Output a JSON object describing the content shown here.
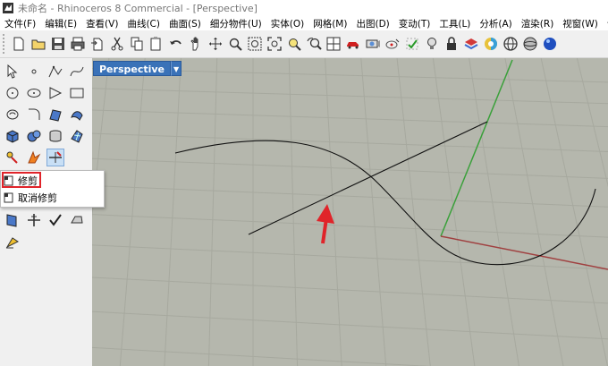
{
  "window": {
    "title": "未命名 - Rhinoceros 8 Commercial - [Perspective]"
  },
  "menu": [
    "文件(F)",
    "编辑(E)",
    "查看(V)",
    "曲线(C)",
    "曲面(S)",
    "细分物件(U)",
    "实体(O)",
    "网格(M)",
    "出图(D)",
    "变动(T)",
    "工具(L)",
    "分析(A)",
    "渲染(R)",
    "视窗(W)",
    "说"
  ],
  "toolbar_icons": [
    "new-icon",
    "open-icon",
    "save-icon",
    "print-icon",
    "import-icon",
    "cut-icon",
    "copy-icon",
    "paste-icon",
    "undo-icon",
    "pan-icon",
    "rotate-view-icon",
    "zoom-icon",
    "zoom-window-icon",
    "zoom-extents-icon",
    "zoom-selected-icon",
    "undo-view-icon",
    "four-viewports-icon",
    "car-icon",
    "camera-icon",
    "target-icon",
    "grid-snap-icon",
    "light-icon",
    "lock-icon",
    "layer-icon",
    "render-color-icon",
    "render-sphere-icon",
    "material-sphere-icon",
    "rendered-view-icon"
  ],
  "viewport": {
    "name": "Perspective",
    "dropdown": "▼"
  },
  "flyout": {
    "items": [
      {
        "label": "修剪"
      },
      {
        "label": "取消修剪"
      }
    ]
  },
  "colors": {
    "viewport_bg": "#b5b7ad",
    "grid_line": "#a9aba1",
    "x_axis": "#a04040",
    "y_axis": "#3aa03a",
    "tab_blue": "#3a72b8",
    "annotation_red": "#e0242a"
  }
}
